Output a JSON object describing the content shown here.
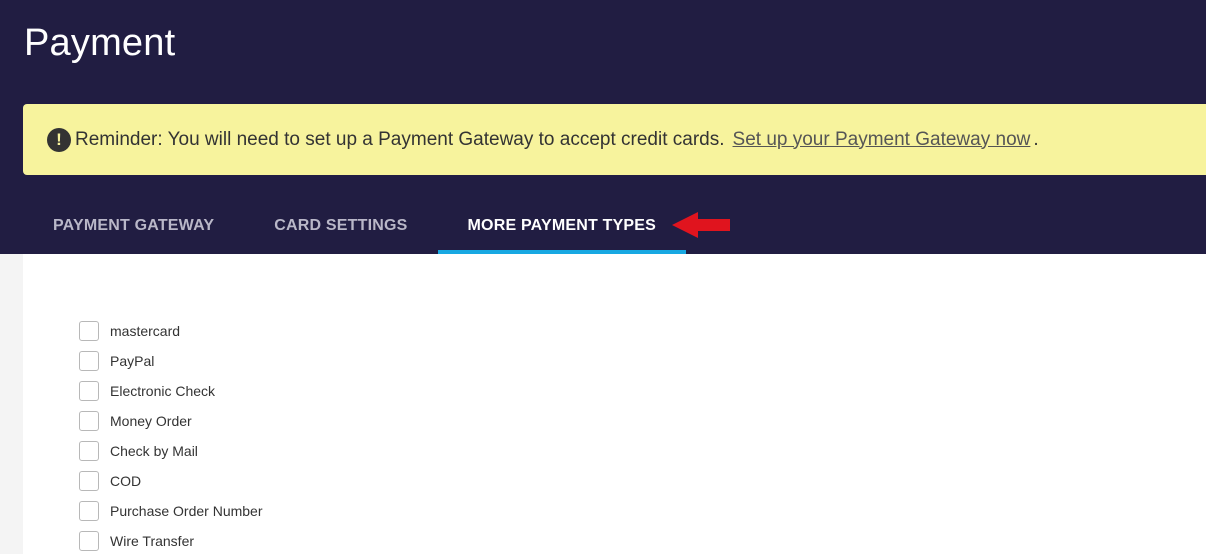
{
  "header": {
    "title": "Payment"
  },
  "reminder": {
    "text": "Reminder: You will need to set up a Payment Gateway to accept credit cards.",
    "link_text": "Set up your Payment Gateway now",
    "trailing": "."
  },
  "tabs": [
    {
      "label": "PAYMENT GATEWAY",
      "active": false
    },
    {
      "label": "CARD SETTINGS",
      "active": false
    },
    {
      "label": "MORE PAYMENT TYPES",
      "active": true
    }
  ],
  "payment_types": [
    {
      "label": "mastercard",
      "checked": false
    },
    {
      "label": "PayPal",
      "checked": false
    },
    {
      "label": "Electronic Check",
      "checked": false
    },
    {
      "label": "Money Order",
      "checked": false
    },
    {
      "label": "Check by Mail",
      "checked": false
    },
    {
      "label": "COD",
      "checked": false
    },
    {
      "label": "Purchase Order Number",
      "checked": false
    },
    {
      "label": "Wire Transfer",
      "checked": false
    }
  ],
  "colors": {
    "header_bg": "#211d42",
    "reminder_bg": "#f7f39d",
    "tab_active_underline": "#18a8e2",
    "annotation_arrow": "#e0141e"
  }
}
